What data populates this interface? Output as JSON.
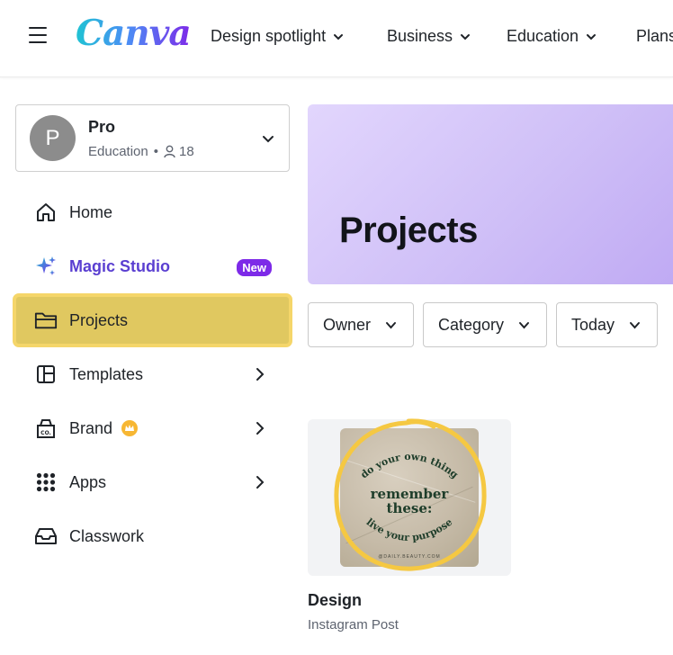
{
  "header": {
    "logo_text": "Canva",
    "nav": [
      {
        "label": "Design spotlight"
      },
      {
        "label": "Business"
      },
      {
        "label": "Education"
      },
      {
        "label": "Plans"
      }
    ]
  },
  "account": {
    "avatar_letter": "P",
    "name": "Pro",
    "plan": "Education",
    "separator": "•",
    "member_count": "18"
  },
  "sidebar": {
    "items": [
      {
        "label": "Home",
        "icon": "home-icon"
      },
      {
        "label": "Magic Studio",
        "icon": "sparkle-icon",
        "badge": "New"
      },
      {
        "label": "Projects",
        "icon": "folder-icon",
        "active": true
      },
      {
        "label": "Templates",
        "icon": "templates-icon"
      },
      {
        "label": "Brand",
        "icon": "brand-icon"
      },
      {
        "label": "Apps",
        "icon": "apps-grid-icon"
      },
      {
        "label": "Classwork",
        "icon": "inbox-tray-icon"
      }
    ]
  },
  "main": {
    "banner_title": "Projects",
    "filters": [
      {
        "label": "Owner"
      },
      {
        "label": "Category"
      },
      {
        "label": "Today"
      }
    ],
    "design_card": {
      "title": "Design",
      "type": "Instagram Post",
      "thumbnail": {
        "top_arc": "do your own thing",
        "center_line1": "remember",
        "center_line2": "these:",
        "bottom_arc": "live your purpose",
        "footer": "@DAILY.BEAUTY.COM"
      }
    }
  },
  "colors": {
    "brand_gradient_start": "#1fc3d3",
    "brand_gradient_end": "#7d2ae8",
    "active_highlight": "#e0c860",
    "badge_purple": "#7d2ae8",
    "banner_lavender": "#cfbff7",
    "annotation_yellow": "#f5c842"
  }
}
